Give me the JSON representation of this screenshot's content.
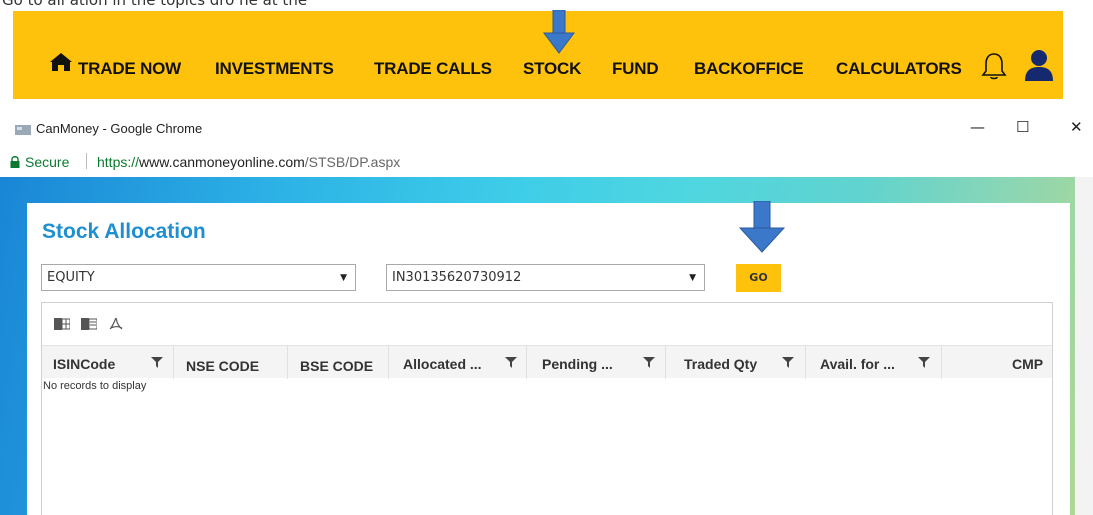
{
  "caption": "Go to all ation in the topics dro ne at the",
  "navbar": {
    "items": [
      "TRADE NOW",
      "INVESTMENTS",
      "TRADE CALLS",
      "STOCK",
      "FUND",
      "BACKOFFICE",
      "CALCULATORS"
    ]
  },
  "window": {
    "title": "CanMoney - Google Chrome",
    "minimize": "—",
    "maximize": "☐",
    "close": "✕"
  },
  "address": {
    "secure_label": "Secure",
    "url_protocol": "https://",
    "url_host": "www.canmoneyonline.com",
    "url_path": "/STSB/DP.aspx"
  },
  "page": {
    "title": "Stock Allocation",
    "category_select": "EQUITY",
    "account_select": "IN30135620730912",
    "go_label": "GO"
  },
  "grid": {
    "columns": [
      "ISINCode",
      "NSE CODE",
      "BSE CODE",
      "Allocated ...",
      "Pending ...",
      "Traded Qty",
      "Avail. for ...",
      "CMP"
    ],
    "empty_message": "No records to display"
  },
  "colors": {
    "nav_bg": "#fec20c",
    "title_blue": "#1f8fd1",
    "arrow_blue": "#3b78c9"
  }
}
